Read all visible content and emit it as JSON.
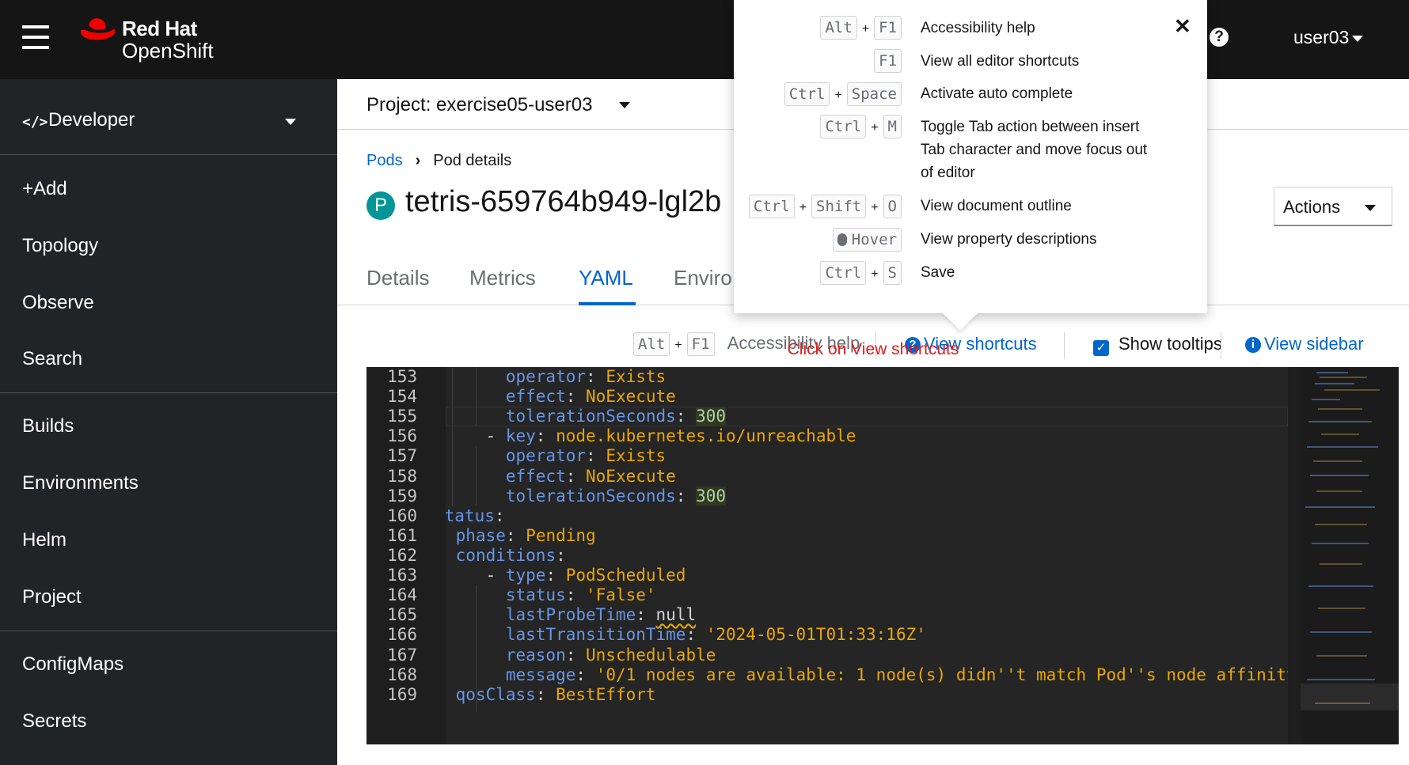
{
  "masthead": {
    "brand_line1": "Red Hat",
    "brand_line2": "OpenShift",
    "user": "user03"
  },
  "sidebar": {
    "perspective": "Developer",
    "items": [
      "+Add",
      "Topology",
      "Observe",
      "Search",
      "Builds",
      "Environments",
      "Helm",
      "Project",
      "ConfigMaps",
      "Secrets"
    ]
  },
  "project": {
    "label": "Project: exercise05-user03"
  },
  "breadcrumb": {
    "link": "Pods",
    "current": "Pod details"
  },
  "pod": {
    "badge": "P",
    "name": "tetris-659764b949-lgl2b"
  },
  "actions_label": "Actions",
  "tabs": [
    "Details",
    "Metrics",
    "YAML",
    "Enviro"
  ],
  "toolbar": {
    "keys": [
      "Alt",
      "F1"
    ],
    "accessibility_help": "Accessibility help",
    "view_shortcuts": "View shortcuts",
    "show_tooltips": "Show tooltips",
    "view_sidebar": "View sidebar"
  },
  "annotation": "Click on View shortcuts",
  "editor": {
    "line_numbers": [
      "153",
      "154",
      "155",
      "156",
      "157",
      "158",
      "159",
      "160",
      "161",
      "162",
      "163",
      "164",
      "165",
      "166",
      "167",
      "168",
      "169"
    ]
  },
  "shortcuts": [
    {
      "keys": [
        "Alt",
        "F1"
      ],
      "desc": "Accessibility help"
    },
    {
      "keys": [
        "F1"
      ],
      "desc": "View all editor shortcuts"
    },
    {
      "keys": [
        "Ctrl",
        "Space"
      ],
      "desc": "Activate auto complete"
    },
    {
      "keys": [
        "Ctrl",
        "M"
      ],
      "desc": "Toggle Tab action between insert Tab character and move focus out of editor"
    },
    {
      "keys": [
        "Ctrl",
        "Shift",
        "O"
      ],
      "desc": "View document outline"
    },
    {
      "keys": [
        "Hover"
      ],
      "desc": "View property descriptions"
    },
    {
      "keys": [
        "Ctrl",
        "S"
      ],
      "desc": "Save"
    }
  ],
  "colors": {
    "masthead": "#151515",
    "sidebar": "#212427",
    "link": "#0066cc",
    "annotation": "#e41a1a"
  }
}
